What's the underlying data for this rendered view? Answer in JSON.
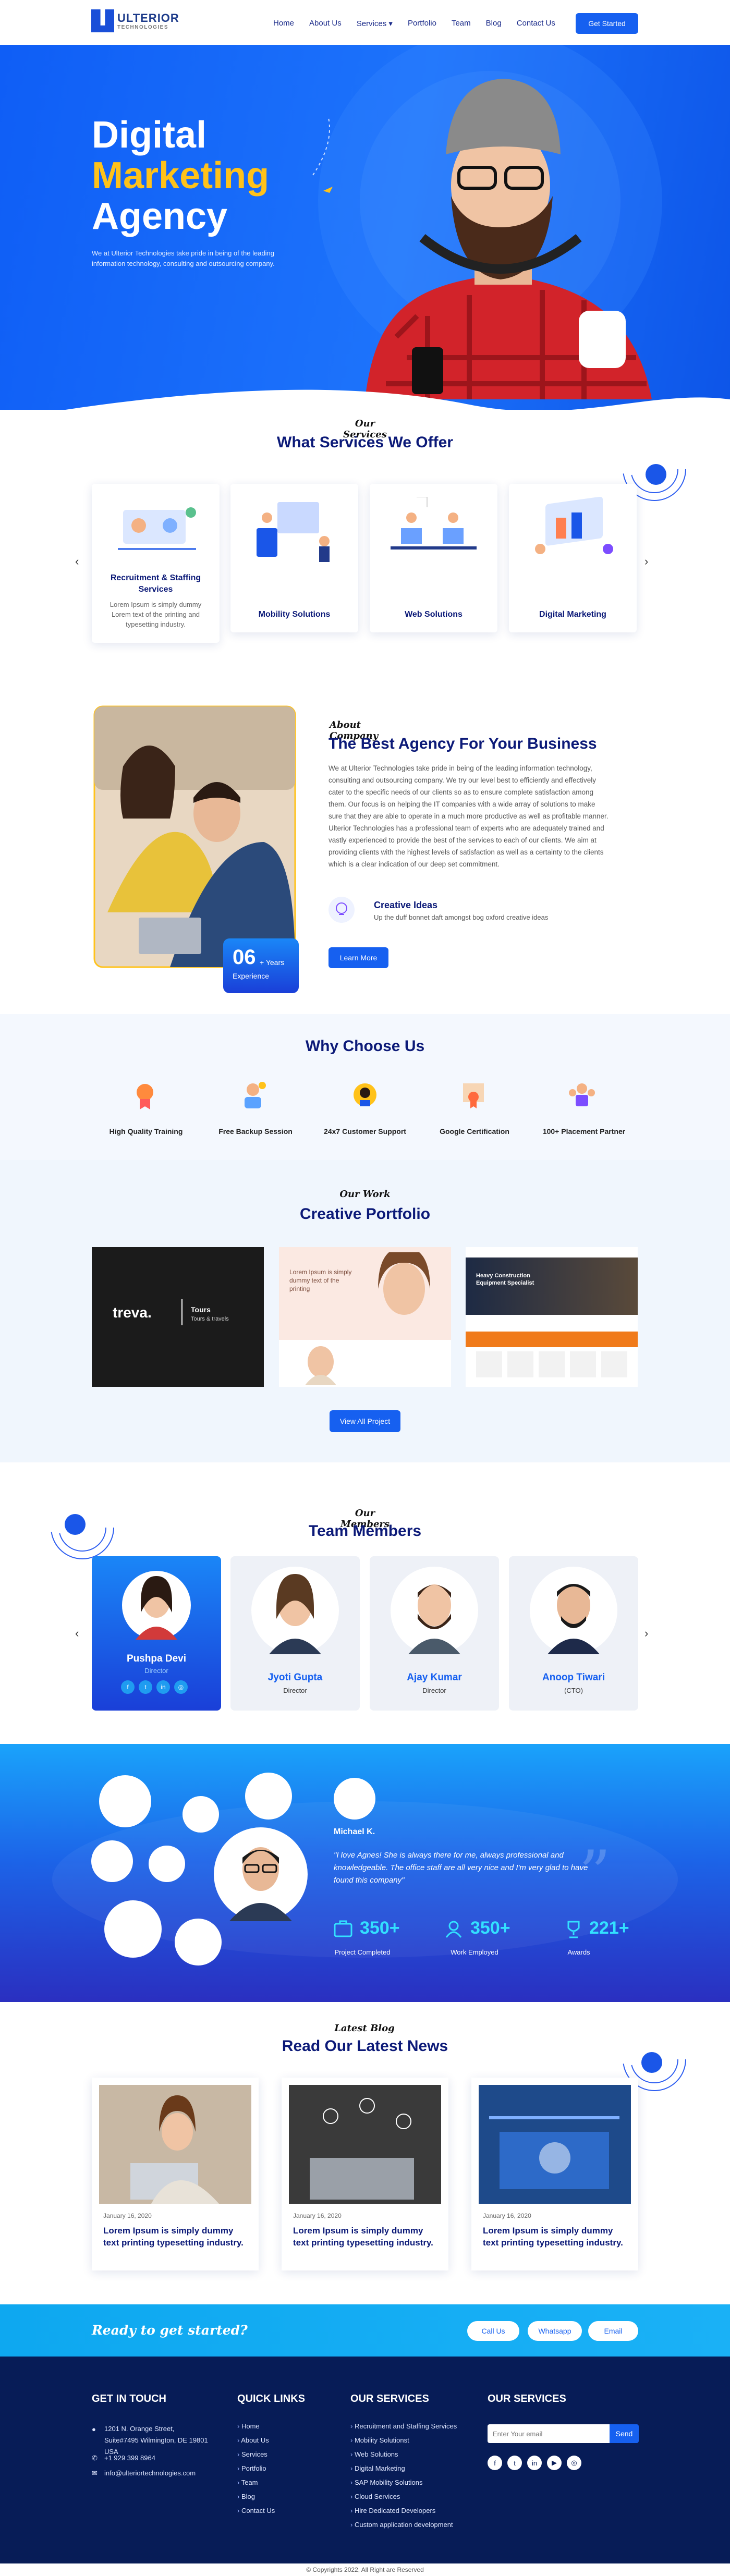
{
  "nav": {
    "logo_word": "ULTERIOR",
    "logo_sub": "TECHNOLOGIES",
    "items": [
      "Home",
      "About Us",
      "Services ▾",
      "Portfolio",
      "Team",
      "Blog",
      "Contact Us"
    ],
    "cta": "Get Started"
  },
  "hero": {
    "line1": "Digital",
    "line2": "Marketing",
    "line3": "Agency",
    "text": "We at Ulterior Technologies take pride in being of the leading information technology, consulting and outsourcing company."
  },
  "services": {
    "tag": "Our Services",
    "title": "What Services We Offer",
    "cards": [
      {
        "title": "Recruitment & Staffing Services",
        "desc": "Lorem Ipsum is simply dummy Lorem text of the printing and typesetting industry."
      },
      {
        "title": "Mobility Solutions",
        "desc": ""
      },
      {
        "title": "Web Solutions",
        "desc": ""
      },
      {
        "title": "Digital Marketing",
        "desc": ""
      }
    ]
  },
  "about": {
    "tag": "About Company",
    "title": "The Best Agency For Your Business",
    "text": "We at Ulterior Technologies take pride in being of the leading information technology, consulting and outsourcing company. We try our level best to efficiently and effectively cater to the specific needs of our clients so as to ensure complete satisfaction among them. Our focus is on helping the IT companies with a wide array of solutions to make sure that they are able to operate in a much more productive as well as profitable manner. Ulterior Technologies has a professional team of experts who are adequately trained and vastly experienced to provide the best of the services to each of our clients. We aim at providing clients with the highest levels of satisfaction as well as a certainty to the clients which is a clear indication of our deep set commitment.",
    "years": "06",
    "years_suffix": "+ Years",
    "years_label": "Experience",
    "feature_title": "Creative Ideas",
    "feature_text": "Up the duff bonnet daft amongst bog oxford creative ideas",
    "button": "Learn More"
  },
  "why": {
    "title": "Why Choose Us",
    "items": [
      "High Quality Training",
      "Free Backup Session",
      "24x7 Customer Support",
      "Google Certification",
      "100+ Placement Partner"
    ]
  },
  "portfolio": {
    "tag": "Our Work",
    "title": "Creative Portfolio",
    "button": "View All Project",
    "p1_brand": "treva.",
    "p1_tag": "Tours",
    "p1_sub": "Tours & travels",
    "p2_headline": "Lorem Ipsum is simply dummy text of the printing",
    "p3_headline": "Heavy Construction Equipment Specialist"
  },
  "team": {
    "tag": "Our Members",
    "title": "Team Members",
    "members": [
      {
        "name": "Pushpa Devi",
        "role": "Director"
      },
      {
        "name": "Jyoti Gupta",
        "role": "Director"
      },
      {
        "name": "Ajay Kumar",
        "role": "Director"
      },
      {
        "name": "Anoop Tiwari",
        "role": "(CTO)"
      }
    ]
  },
  "testimonial": {
    "name": "Michael K.",
    "quote": "\"I love Agnes! She is always there for me, always professional and knowledgeable. The office staff are all very nice and I'm very glad to have found this company\"",
    "stats": [
      {
        "value": "350+",
        "label": "Project Completed"
      },
      {
        "value": "350+",
        "label": "Work Employed"
      },
      {
        "value": "221+",
        "label": "Awards"
      }
    ]
  },
  "news": {
    "tag": "Latest Blog",
    "title": "Read Our Latest News",
    "posts": [
      {
        "date": "January 16, 2020",
        "title": "Lorem Ipsum is simply dummy text printing typesetting industry."
      },
      {
        "date": "January 16, 2020",
        "title": "Lorem Ipsum is simply dummy text printing typesetting industry."
      },
      {
        "date": "January 16, 2020",
        "title": "Lorem Ipsum is simply dummy text printing typesetting industry."
      }
    ]
  },
  "cta": {
    "text": "Ready to get started?",
    "buttons": [
      "Call Us",
      "Whatsapp",
      "Email"
    ]
  },
  "footer": {
    "touch_title": "GET IN TOUCH",
    "address": "1201 N. Orange Street, Suite#7495 Wilmington, DE 19801 USA",
    "phone": "+1 929 399 8964",
    "email": "info@ulteriortechnologies.com",
    "quick_title": "QUICK LINKS",
    "quick": [
      "Home",
      "About Us",
      "Services",
      "Portfolio",
      "Team",
      "Blog",
      "Contact Us"
    ],
    "services_title": "OUR SERVICES",
    "services": [
      "Recruitment and Staffing Services",
      "Mobility Solutionst",
      "Web Solutions",
      "Digital Marketing",
      "SAP Mobility Solutions",
      "Cloud Services",
      "Hire Dedicated Developers",
      "Custom application development"
    ],
    "newsletter_title": "OUR SERVICES",
    "email_placeholder": "Enter Your email",
    "send": "Send",
    "copyright": "© Copyrights 2022, All Right are Reserved"
  }
}
